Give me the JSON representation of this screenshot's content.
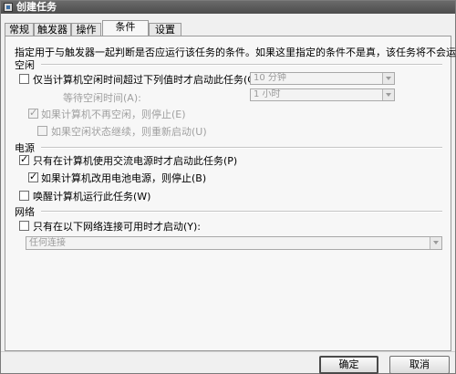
{
  "window": {
    "title": "创建任务"
  },
  "tabs": [
    {
      "label": "常规"
    },
    {
      "label": "触发器"
    },
    {
      "label": "操作"
    },
    {
      "label": "条件"
    },
    {
      "label": "设置"
    }
  ],
  "description": "指定用于与触发器一起判断是否应运行该任务的条件。如果这里指定的条件不是真，该任务将不会运行。",
  "idle": {
    "section_label": "空闲",
    "start_only_if_idle": {
      "label": "仅当计算机空闲时间超过下列值时才启动此任务(C):",
      "checked": false
    },
    "idle_duration": {
      "value": "10 分钟"
    },
    "wait_label": "等待空闲时间(A):",
    "wait_duration": {
      "value": "1 小时"
    },
    "stop_if_not_idle": {
      "label": "如果计算机不再空闲，则停止(E)",
      "checked": true
    },
    "restart_if_idle": {
      "label": "如果空闲状态继续，则重新启动(U)",
      "checked": false
    }
  },
  "power": {
    "section_label": "电源",
    "ac_only": {
      "label": "只有在计算机使用交流电源时才启动此任务(P)",
      "checked": true
    },
    "stop_on_battery": {
      "label": "如果计算机改用电池电源，则停止(B)",
      "checked": true
    },
    "wake_to_run": {
      "label": "唤醒计算机运行此任务(W)",
      "checked": false
    }
  },
  "network": {
    "section_label": "网络",
    "only_if_network": {
      "label": "只有在以下网络连接可用时才启动(Y):",
      "checked": false
    },
    "connection": {
      "value": "任何连接"
    }
  },
  "buttons": {
    "ok": "确定",
    "cancel": "取消"
  }
}
